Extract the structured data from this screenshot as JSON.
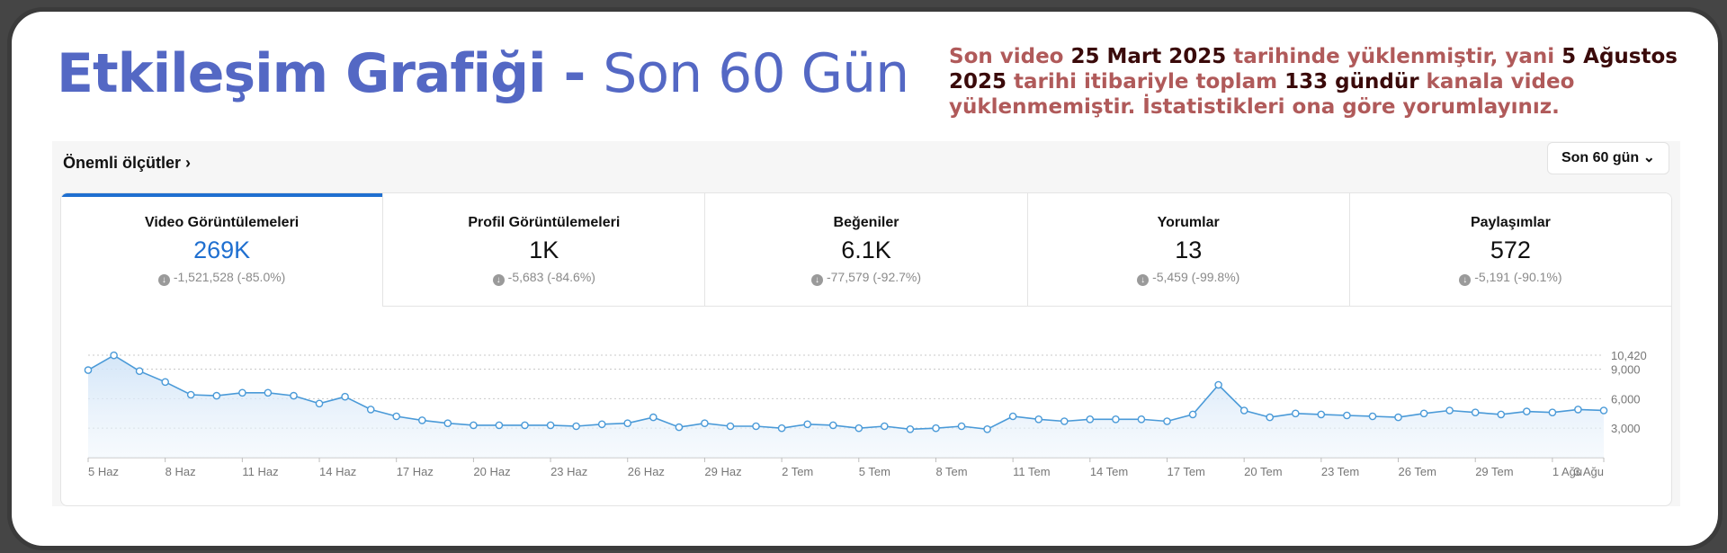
{
  "header": {
    "title_bold": "Etkileşim Grafiği - ",
    "title_light": "Son 60 Gün"
  },
  "note": {
    "p1": "Son video ",
    "b1": "25 Mart 2025",
    "p2": " tarihinde yüklenmiştir, yani ",
    "b2": "5 Ağustos 2025",
    "p3": " tarihi itibariyle toplam ",
    "b3": "133 gündür",
    "p4": " kanala video yüklenmemiştir. İstatistikleri ona göre yorumlayınız."
  },
  "panel": {
    "metrics_title": "Önemli ölçütler ›",
    "range_button": "Son 60 gün ⌄"
  },
  "tabs": [
    {
      "label": "Video Görüntülemeleri",
      "value": "269K",
      "change": "-1,521,528 (-85.0%)"
    },
    {
      "label": "Profil Görüntülemeleri",
      "value": "1K",
      "change": "-5,683 (-84.6%)"
    },
    {
      "label": "Beğeniler",
      "value": "6.1K",
      "change": "-77,579 (-92.7%)"
    },
    {
      "label": "Yorumlar",
      "value": "13",
      "change": "-5,459 (-99.8%)"
    },
    {
      "label": "Paylaşımlar",
      "value": "572",
      "change": "-5,191 (-90.1%)"
    }
  ],
  "colors": {
    "accent": "#1f6fd0",
    "line": "#4a9ad8",
    "title": "#5468c4",
    "note": "#b05a5a"
  },
  "chart_data": {
    "type": "area",
    "title": "",
    "xlabel": "",
    "ylabel": "",
    "x_tick_labels": [
      "5 Haz",
      "8 Haz",
      "11 Haz",
      "14 Haz",
      "17 Haz",
      "20 Haz",
      "23 Haz",
      "26 Haz",
      "29 Haz",
      "2 Tem",
      "5 Tem",
      "8 Tem",
      "11 Tem",
      "14 Tem",
      "17 Tem",
      "20 Tem",
      "23 Tem",
      "26 Tem",
      "29 Tem",
      "1 Ağu",
      "3 Ağu"
    ],
    "x_tick_index": [
      0,
      3,
      6,
      9,
      12,
      15,
      18,
      21,
      24,
      27,
      30,
      33,
      36,
      39,
      42,
      45,
      48,
      51,
      54,
      57,
      59
    ],
    "y_ticks": [
      3000,
      6000,
      9000,
      10420
    ],
    "ylim": [
      0,
      10420
    ],
    "grid": true,
    "values": [
      8900,
      10400,
      8800,
      7700,
      6400,
      6300,
      6600,
      6600,
      6300,
      5500,
      6200,
      4900,
      4200,
      3800,
      3500,
      3300,
      3300,
      3300,
      3300,
      3200,
      3400,
      3500,
      4100,
      3100,
      3500,
      3200,
      3200,
      3000,
      3400,
      3300,
      3000,
      3200,
      2900,
      3000,
      3200,
      2900,
      4200,
      3900,
      3700,
      3900,
      3900,
      3900,
      3700,
      4400,
      7400,
      4800,
      4100,
      4500,
      4400,
      4300,
      4200,
      4100,
      4500,
      4800,
      4600,
      4400,
      4700,
      4600,
      4900,
      4800
    ]
  }
}
